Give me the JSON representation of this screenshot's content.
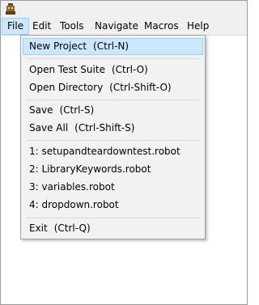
{
  "menubar": {
    "items": [
      {
        "label": "File"
      },
      {
        "label": "Edit"
      },
      {
        "label": "Tools"
      },
      {
        "label": "Navigate"
      },
      {
        "label": "Macros"
      },
      {
        "label": "Help"
      }
    ]
  },
  "file_menu": {
    "new_project": {
      "label": "New Project",
      "shortcut": "(Ctrl-N)"
    },
    "open_test_suite": {
      "label": "Open Test Suite",
      "shortcut": "(Ctrl-O)"
    },
    "open_directory": {
      "label": "Open Directory",
      "shortcut": "(Ctrl-Shift-O)"
    },
    "save": {
      "label": "Save",
      "shortcut": "(Ctrl-S)"
    },
    "save_all": {
      "label": "Save All",
      "shortcut": "(Ctrl-Shift-S)"
    },
    "recent": [
      "1: setupandteardowntest.robot",
      "2: LibraryKeywords.robot",
      "3: variables.robot",
      "4: dropdown.robot"
    ],
    "exit": {
      "label": "Exit",
      "shortcut": "(Ctrl-Q)"
    }
  },
  "colors": {
    "highlight": "#cce8ff",
    "highlight_border": "#99d1ff",
    "menu_bg": "#f2f2f2"
  }
}
